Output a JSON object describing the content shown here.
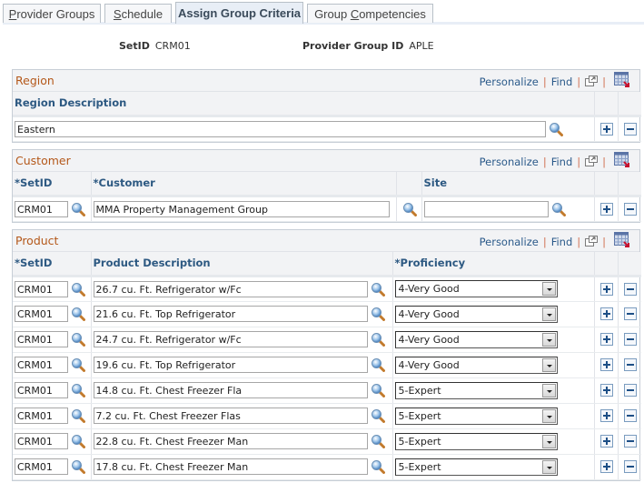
{
  "tabs": [
    {
      "label_pre": "",
      "label_u": "P",
      "label_post": "rovider Groups",
      "active": false
    },
    {
      "label_pre": "",
      "label_u": "S",
      "label_post": "chedule",
      "active": false
    },
    {
      "label_pre": "Assign Group Criteria",
      "label_u": "",
      "label_post": "",
      "active": true
    },
    {
      "label_pre": "Group ",
      "label_u": "C",
      "label_post": "ompetencies",
      "active": false
    }
  ],
  "header": {
    "setid_label": "SetID",
    "setid_value": "CRM01",
    "provider_group_label": "Provider Group ID",
    "provider_group_value": "APLE"
  },
  "grid_tools": {
    "personalize": "Personalize",
    "find": "Find",
    "sep": "|"
  },
  "region": {
    "title": "Region",
    "columns": [
      "Region Description"
    ],
    "rows": [
      {
        "description": "Eastern"
      }
    ]
  },
  "customer": {
    "title": "Customer",
    "columns": [
      "*SetID",
      "*Customer",
      "Site"
    ],
    "rows": [
      {
        "setid": "CRM01",
        "customer": "MMA Property Management Group",
        "site": ""
      }
    ]
  },
  "product": {
    "title": "Product",
    "columns": [
      "*SetID",
      "Product Description",
      "*Proficiency"
    ],
    "rows": [
      {
        "setid": "CRM01",
        "description": "26.7 cu. Ft. Refrigerator w/Fc",
        "proficiency": "4-Very Good"
      },
      {
        "setid": "CRM01",
        "description": "21.6 cu. Ft. Top Refrigerator",
        "proficiency": "4-Very Good"
      },
      {
        "setid": "CRM01",
        "description": "24.7 cu. Ft. Refrigerator w/Fc",
        "proficiency": "4-Very Good"
      },
      {
        "setid": "CRM01",
        "description": "19.6 cu. Ft. Top Refrigerator",
        "proficiency": "4-Very Good"
      },
      {
        "setid": "CRM01",
        "description": "14.8 cu. Ft. Chest Freezer Fla",
        "proficiency": "5-Expert"
      },
      {
        "setid": "CRM01",
        "description": "7.2 cu. Ft. Chest Freezer Flas",
        "proficiency": "5-Expert"
      },
      {
        "setid": "CRM01",
        "description": "22.8 cu. Ft. Chest Freezer Man",
        "proficiency": "5-Expert"
      },
      {
        "setid": "CRM01",
        "description": "17.8 cu. Ft. Chest Freezer Man",
        "proficiency": "5-Expert"
      }
    ]
  }
}
